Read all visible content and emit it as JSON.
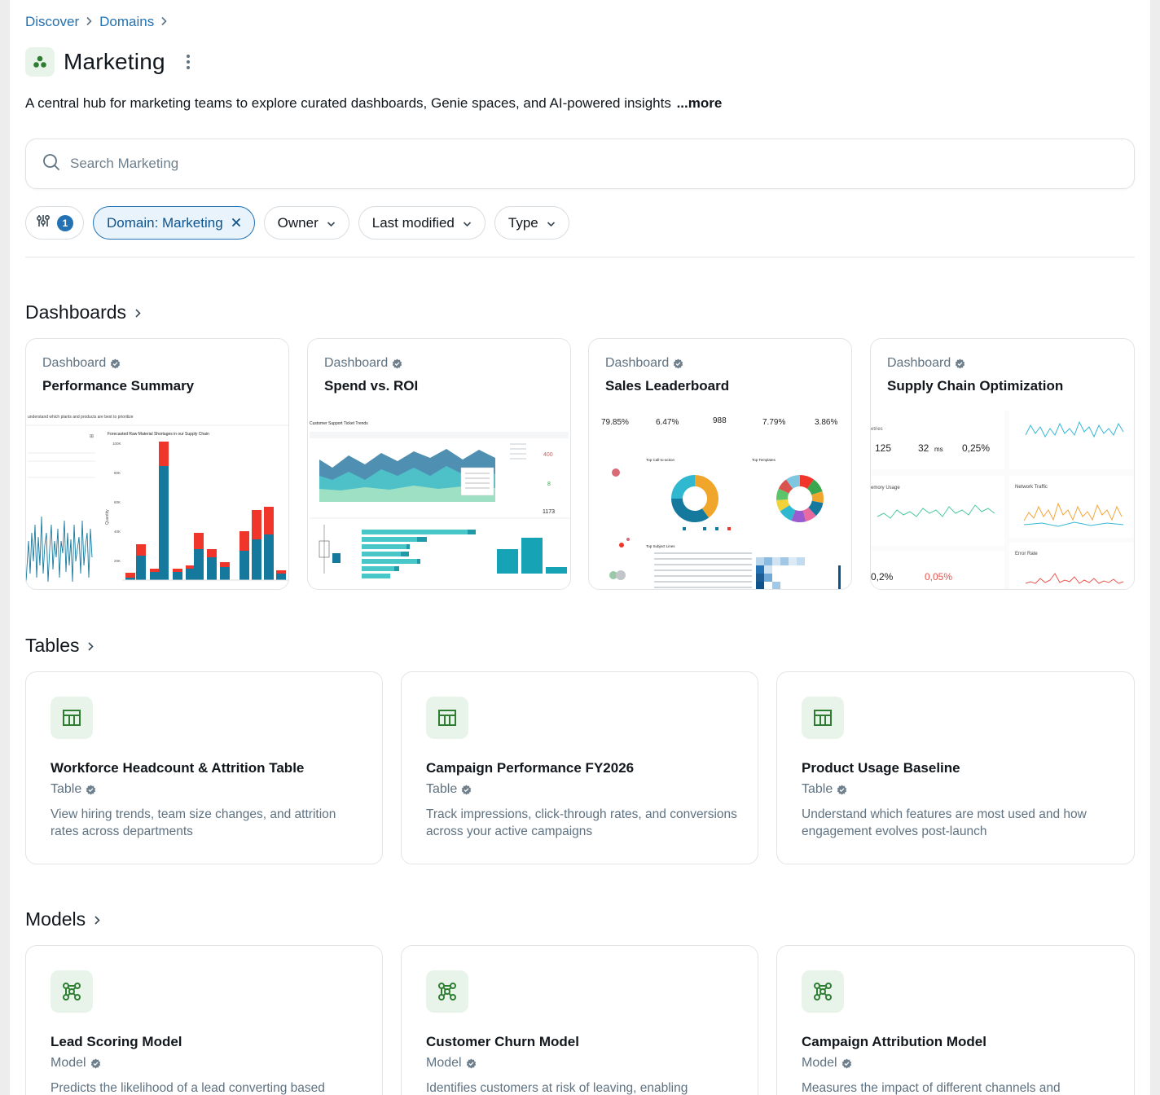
{
  "breadcrumb": {
    "items": [
      "Discover",
      "Domains"
    ]
  },
  "header": {
    "title": "Marketing",
    "description": "A central hub for marketing teams to explore curated dashboards, Genie spaces, and AI-powered insights",
    "more_label": "...more"
  },
  "search": {
    "placeholder": "Search Marketing",
    "value": ""
  },
  "filters": {
    "active_count": "1",
    "domain_chip": "Domain: Marketing",
    "owner": "Owner",
    "last_modified": "Last modified",
    "type": "Type"
  },
  "sections": {
    "dashboards": "Dashboards",
    "tables": "Tables",
    "models": "Models"
  },
  "dashboards": [
    {
      "kind": "Dashboard",
      "name": "Performance Summary"
    },
    {
      "kind": "Dashboard",
      "name": "Spend vs. ROI"
    },
    {
      "kind": "Dashboard",
      "name": "Sales Leaderboard"
    },
    {
      "kind": "Dashboard",
      "name": "Supply Chain Optimization"
    }
  ],
  "thumbs": {
    "perf": {
      "subtitle": "understand which plants and products are best to prioritize",
      "chart_title": "Forecasted Raw Material Shortages in our Supply Chain",
      "ylabel": "Quantity",
      "ticks": [
        "100K",
        "80K",
        "60K",
        "40K",
        "20K"
      ]
    },
    "spend": {
      "title": "Customer Support Ticket Trends",
      "value1": "400",
      "value2": "8",
      "value3": "1173"
    },
    "sales": {
      "kpis": [
        "79.85%",
        "6.47%",
        "988",
        "7.79%",
        "3.86%"
      ],
      "donut1_title": "Top Call-to-action",
      "donut2_title": "Top Templates",
      "list_title": "Top Subject Lines"
    },
    "supply": {
      "m1": "125",
      "m2": "32",
      "m2_unit": "ms",
      "m3": "0,25%",
      "mem": "emory Usage",
      "net": "Network Traffic",
      "err": "Error Rate",
      "b1": "0,2%",
      "b2": "0,05%",
      "lbl": "etries"
    }
  },
  "tables": [
    {
      "name": "Workforce Headcount & Attrition Table",
      "kind": "Table",
      "desc": "View hiring trends, team size changes, and attrition rates across departments"
    },
    {
      "name": "Campaign Performance FY2026",
      "kind": "Table",
      "desc": "Track impressions, click-through rates, and conversions across your active campaigns"
    },
    {
      "name": "Product Usage Baseline",
      "kind": "Table",
      "desc": "Understand which features are most used and how engagement evolves post-launch"
    }
  ],
  "models": [
    {
      "name": "Lead Scoring Model",
      "kind": "Model",
      "desc": "Predicts the likelihood of a lead converting based"
    },
    {
      "name": "Customer Churn Model",
      "kind": "Model",
      "desc": "Identifies customers at risk of leaving, enabling"
    },
    {
      "name": "Campaign Attribution Model",
      "kind": "Model",
      "desc": "Measures the impact of different channels and"
    }
  ],
  "colors": {
    "accent": "#2272b4",
    "green": "#3a8a3f",
    "teal": "#15799e",
    "red": "#f0352b"
  }
}
